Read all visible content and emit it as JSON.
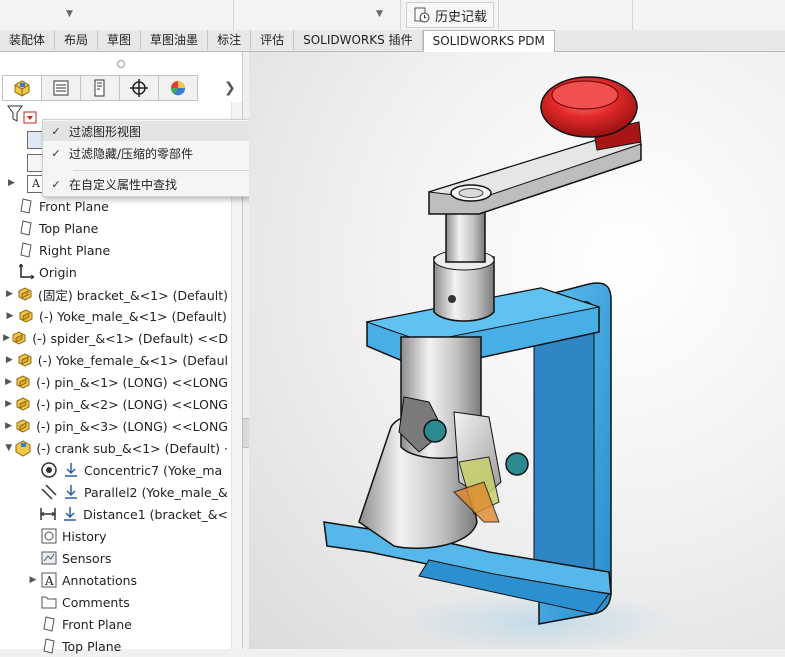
{
  "toolbar": {
    "history_label": "历史记载"
  },
  "command_tabs": [
    {
      "label": "装配体",
      "active": false
    },
    {
      "label": "布局",
      "active": false
    },
    {
      "label": "草图",
      "active": false
    },
    {
      "label": "草图油墨",
      "active": false
    },
    {
      "label": "标注",
      "active": false
    },
    {
      "label": "评估",
      "active": false
    },
    {
      "label": "SOLIDWORKS 插件",
      "active": false
    },
    {
      "label": "SOLIDWORKS PDM",
      "active": true
    }
  ],
  "panel_tabs": [
    {
      "icon": "feature-manager-icon",
      "selected": true
    },
    {
      "icon": "property-manager-icon",
      "selected": false
    },
    {
      "icon": "configuration-manager-icon",
      "selected": false
    },
    {
      "icon": "dimxpert-manager-icon",
      "selected": false
    },
    {
      "icon": "display-manager-icon",
      "selected": false
    }
  ],
  "filter_menu": {
    "items": [
      {
        "label": "过滤图形视图",
        "checked": true,
        "highlighted": true
      },
      {
        "label": "过滤隐藏/压缩的零部件",
        "checked": true,
        "highlighted": false
      },
      {
        "label": "在自定义属性中查找",
        "checked": true,
        "highlighted": false
      }
    ]
  },
  "tree": {
    "items": [
      {
        "label": "Front Plane",
        "icon": "plane-icon",
        "indent": 0,
        "expand": "none"
      },
      {
        "label": "Top Plane",
        "icon": "plane-icon",
        "indent": 0,
        "expand": "none"
      },
      {
        "label": "Right Plane",
        "icon": "plane-icon",
        "indent": 0,
        "expand": "none"
      },
      {
        "label": "Origin",
        "icon": "origin-icon",
        "indent": 0,
        "expand": "none"
      },
      {
        "label": "(固定) bracket_&<1> (Default)",
        "icon": "part-icon",
        "indent": 0,
        "expand": "collapsed"
      },
      {
        "label": "(-) Yoke_male_&<1> (Default)",
        "icon": "part-icon",
        "indent": 0,
        "expand": "collapsed"
      },
      {
        "label": "(-) spider_&<1> (Default) <<D",
        "icon": "part-icon",
        "indent": 0,
        "expand": "collapsed"
      },
      {
        "label": "(-) Yoke_female_&<1> (Defaul",
        "icon": "part-icon",
        "indent": 0,
        "expand": "collapsed"
      },
      {
        "label": "(-) pin_&<1> (LONG) <<LONG",
        "icon": "part-icon",
        "indent": 0,
        "expand": "collapsed"
      },
      {
        "label": "(-) pin_&<2> (LONG) <<LONG",
        "icon": "part-icon",
        "indent": 0,
        "expand": "collapsed"
      },
      {
        "label": "(-) pin_&<3> (LONG) <<LONG",
        "icon": "part-icon",
        "indent": 0,
        "expand": "collapsed"
      },
      {
        "label": "(-) crank sub_&<1> (Default) ·",
        "icon": "subassembly-icon",
        "indent": 0,
        "expand": "expanded"
      },
      {
        "label": "Concentric7 (Yoke_ma",
        "icon": "concentric-mate-icon",
        "indent": 1,
        "expand": "none"
      },
      {
        "label": "Parallel2 (Yoke_male_&",
        "icon": "parallel-mate-icon",
        "indent": 1,
        "expand": "none"
      },
      {
        "label": "Distance1 (bracket_&<",
        "icon": "distance-mate-icon",
        "indent": 1,
        "expand": "none"
      },
      {
        "label": "History",
        "icon": "history-folder-icon",
        "indent": 1,
        "expand": "none"
      },
      {
        "label": "Sensors",
        "icon": "sensors-icon",
        "indent": 1,
        "expand": "none"
      },
      {
        "label": "Annotations",
        "icon": "annotations-icon",
        "indent": 1,
        "expand": "collapsed"
      },
      {
        "label": "Comments",
        "icon": "comments-icon",
        "indent": 1,
        "expand": "none"
      },
      {
        "label": "Front Plane",
        "icon": "plane-icon",
        "indent": 1,
        "expand": "none"
      },
      {
        "label": "Top Plane",
        "icon": "plane-icon",
        "indent": 1,
        "expand": "none"
      }
    ]
  },
  "colors": {
    "bracket_blue": "#3aa5e0",
    "knob_red": "#e02a2a",
    "steel": "#c9c9c9",
    "accent_orange": "#e07a2a"
  }
}
